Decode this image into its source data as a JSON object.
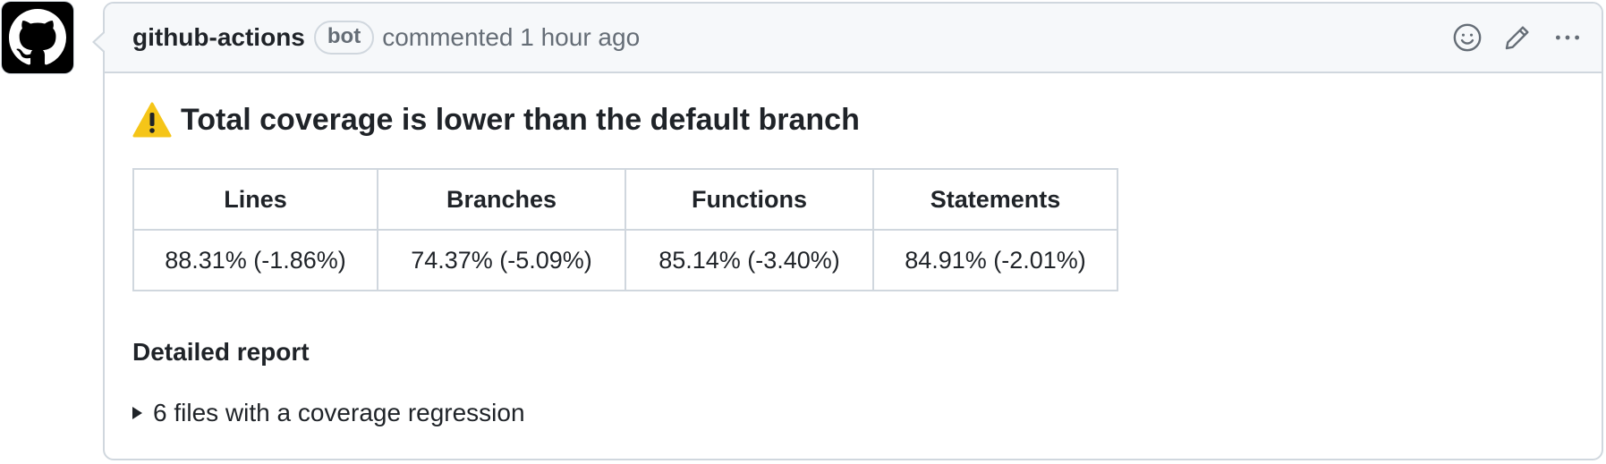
{
  "author": {
    "name": "github-actions",
    "badge": "bot",
    "action_text": "commented 1 hour ago",
    "avatar_icon": "github-octocat-icon"
  },
  "header_actions": {
    "reaction_icon": "smiley-icon",
    "edit_icon": "pencil-icon",
    "more_icon": "kebab-horizontal-icon"
  },
  "body": {
    "heading_icon": "warning-icon",
    "heading": "Total coverage is lower than the default branch",
    "table": {
      "headers": [
        "Lines",
        "Branches",
        "Functions",
        "Statements"
      ],
      "values": [
        "88.31% (-1.86%)",
        "74.37% (-5.09%)",
        "85.14% (-3.40%)",
        "84.91% (-2.01%)"
      ]
    },
    "detailed_report": "Detailed report",
    "summary": "6 files with a coverage regression"
  },
  "colors": {
    "border": "#d0d7de",
    "header_bg": "#f6f8fa",
    "text": "#1f2328",
    "muted": "#656d76",
    "warning": "#f5c518"
  }
}
